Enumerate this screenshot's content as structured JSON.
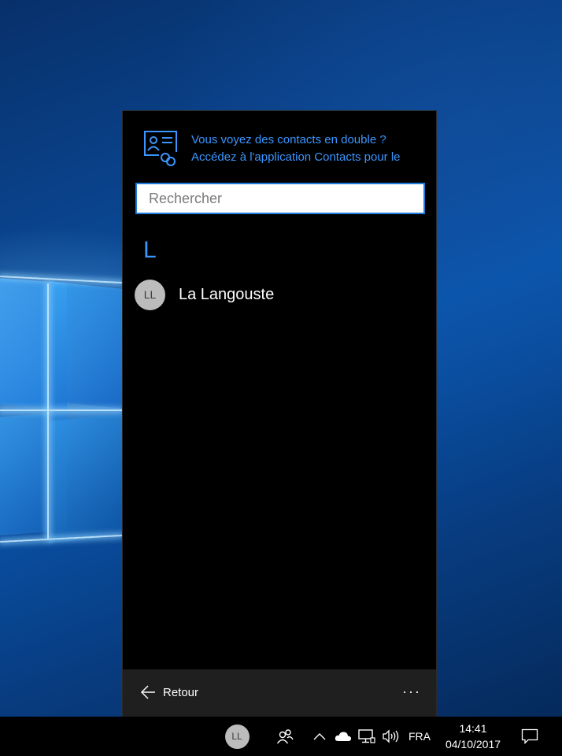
{
  "banner": {
    "line1": "Vous voyez des contacts en double ?",
    "line2": "Accédez à l'application Contacts pour le",
    "icon": "contact-link-icon"
  },
  "search": {
    "placeholder": "Rechercher",
    "value": ""
  },
  "group": {
    "letter": "L"
  },
  "contacts": [
    {
      "initials": "LL",
      "name": "La Langouste"
    }
  ],
  "footer": {
    "back_label": "Retour",
    "more_label": "···"
  },
  "taskbar": {
    "pinned_contact_initials": "LL",
    "language": "FRA",
    "time": "14:41",
    "date": "04/10/2017"
  },
  "colors": {
    "accent": "#3a96ff",
    "flyout_bg": "#000000",
    "footer_bg": "#1f1f1f",
    "taskbar_bg": "#000000"
  }
}
